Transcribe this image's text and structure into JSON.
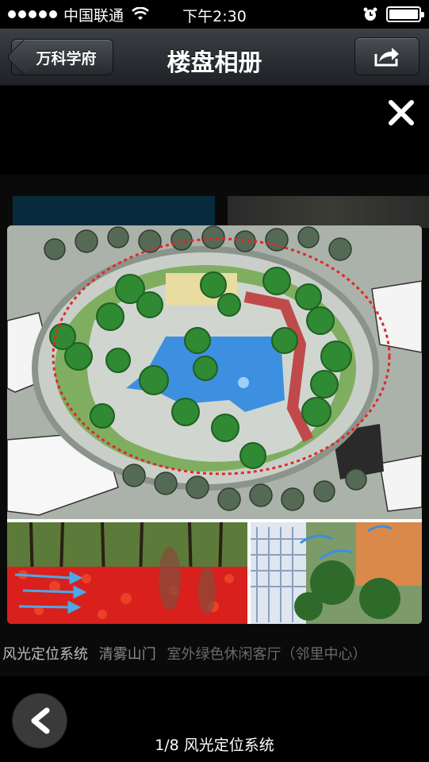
{
  "status_bar": {
    "carrier": "中国联通",
    "time": "下午2:30"
  },
  "nav": {
    "back_label": "万科学府",
    "title": "楼盘相册"
  },
  "gallery": {
    "captions": [
      "风光定位系统",
      "清雾山门",
      "室外绿色休闲客厅（邻里中心）"
    ],
    "counter": "1/8 风光定位系统"
  },
  "colors": {
    "nav_top": "#3b4046",
    "nav_bottom": "#1e2125",
    "accent_pool": "#3d8fe0",
    "tree_green": "#2f8a33",
    "flower_red": "#d9201c"
  },
  "icons": {
    "close": "close-icon",
    "share": "share-icon",
    "back": "chevron-left-icon"
  }
}
